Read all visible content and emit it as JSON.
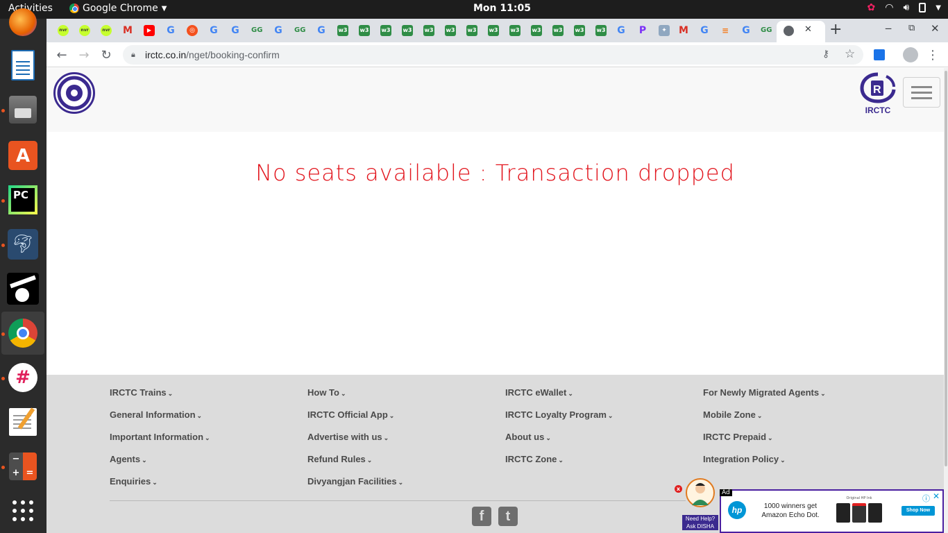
{
  "system": {
    "activities": "Activities",
    "app_name": "Google Chrome",
    "clock": "Mon 11:05"
  },
  "browser": {
    "url_host": "irctc.co.in",
    "url_path": "/nget/booking-confirm",
    "tab_close": "✕",
    "new_tab": "+"
  },
  "page": {
    "message": "No seats available : Transaction dropped",
    "brand": "IRCTC"
  },
  "footer": {
    "columns": [
      [
        "IRCTC Trains",
        "General Information",
        "Important Information",
        "Agents",
        "Enquiries"
      ],
      [
        "How To",
        "IRCTC Official App",
        "Advertise with us",
        "Refund Rules",
        "Divyangjan Facilities"
      ],
      [
        "IRCTC eWallet",
        "IRCTC Loyalty Program",
        "About us",
        "IRCTC Zone"
      ],
      [
        "For Newly Migrated Agents",
        "Mobile Zone",
        "IRCTC Prepaid",
        "Integration Policy"
      ]
    ],
    "social": {
      "facebook": "f",
      "twitter": "t"
    }
  },
  "disha": {
    "line1": "Need Help?",
    "line2": "Ask DISHA"
  },
  "ad": {
    "tag": "Ad",
    "headline": "1000 winners get Amazon Echo Dot.",
    "product_label": "Original HP Ink",
    "cta": "Shop Now"
  },
  "colors": {
    "message": "#e2141c",
    "irctc_purple": "#3b2a8f",
    "footer_bg": "#dcdcdc"
  }
}
